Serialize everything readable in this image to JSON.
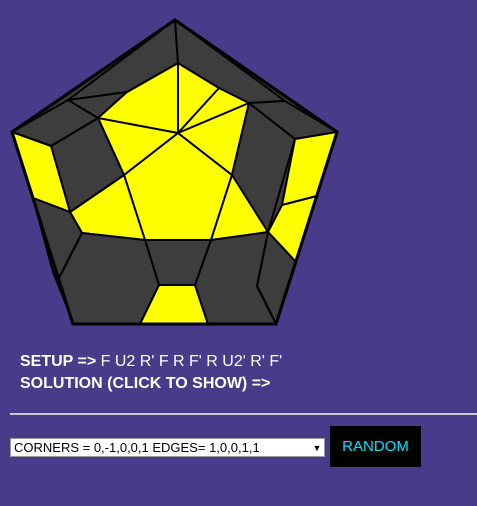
{
  "colors": {
    "background": "#473b8a",
    "sticker_on": "#ffff00",
    "sticker_off": "#3d3d3d",
    "outline": "#000000",
    "button_text": "#00e5ff"
  },
  "setup": {
    "label": "SETUP =>",
    "moves": "F U2 R' F R F' R U2' R' F'"
  },
  "solution": {
    "label": "SOLUTION (CLICK TO SHOW) =>"
  },
  "controls": {
    "case_value": "CORNERS = 0,-1,0,0,1 EDGES= 1,0,0,1,1",
    "random_label": "RANDOM"
  },
  "puzzle": {
    "stickers": [
      {
        "name": "center-piece",
        "color": "sticker_on"
      },
      {
        "name": "inner-corner-top",
        "color": "sticker_on"
      },
      {
        "name": "inner-corner-right",
        "color": "sticker_on"
      },
      {
        "name": "inner-corner-bottom-right",
        "color": "sticker_on"
      },
      {
        "name": "inner-corner-bottom-left",
        "color": "sticker_on"
      },
      {
        "name": "inner-corner-left",
        "color": "sticker_on"
      },
      {
        "name": "inner-edge-top-left",
        "color": "sticker_on"
      },
      {
        "name": "inner-edge-top-right",
        "color": "sticker_on"
      },
      {
        "name": "inner-edge-right",
        "color": "sticker_off"
      },
      {
        "name": "inner-edge-bottom",
        "color": "sticker_off"
      },
      {
        "name": "inner-edge-left",
        "color": "sticker_off"
      },
      {
        "name": "outer-top-left",
        "color": "sticker_off"
      },
      {
        "name": "outer-top-right",
        "color": "sticker_off"
      },
      {
        "name": "outer-upper-left",
        "color": "sticker_off"
      },
      {
        "name": "outer-upper-right",
        "color": "sticker_off"
      },
      {
        "name": "outer-left-top",
        "color": "sticker_on"
      },
      {
        "name": "outer-right-top",
        "color": "sticker_on"
      },
      {
        "name": "outer-left-mid",
        "color": "sticker_off"
      },
      {
        "name": "outer-right-mid",
        "color": "sticker_on"
      },
      {
        "name": "outer-left-low",
        "color": "sticker_off"
      },
      {
        "name": "outer-right-low",
        "color": "sticker_off"
      },
      {
        "name": "outer-bottom-left",
        "color": "sticker_off"
      },
      {
        "name": "outer-bottom-mid",
        "color": "sticker_on"
      },
      {
        "name": "outer-bottom-right",
        "color": "sticker_off"
      }
    ]
  }
}
